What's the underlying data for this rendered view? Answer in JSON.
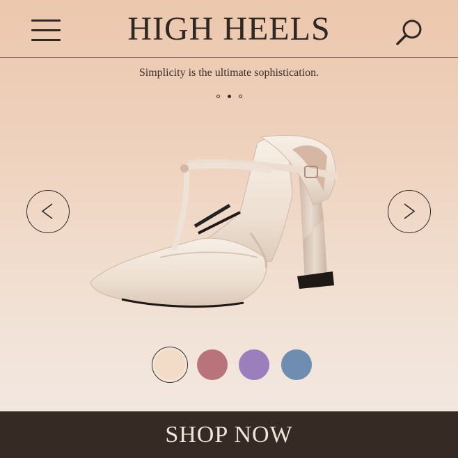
{
  "header": {
    "title": "HIGH HEELS",
    "menu_icon": "hamburger-menu-icon",
    "search_icon": "search-icon"
  },
  "tagline": "Simplicity is the ultimate sophistication.",
  "carousel": {
    "total_slides": 3,
    "active_slide": 2,
    "prev_icon": "chevron-left-icon",
    "next_icon": "chevron-right-icon",
    "product_image": "cream-t-strap-pointed-high-heels"
  },
  "color_options": [
    {
      "color": "#f2dcc8",
      "selected": true
    },
    {
      "color": "#b9737a",
      "selected": false
    },
    {
      "color": "#9b7fbd",
      "selected": false
    },
    {
      "color": "#6f8db1",
      "selected": false
    }
  ],
  "cta": {
    "label": "SHOP NOW"
  },
  "colors": {
    "accent": "#352b24",
    "text": "#2f2722",
    "background_top": "#ecc7ad",
    "background_bottom": "#f3ebe5"
  }
}
